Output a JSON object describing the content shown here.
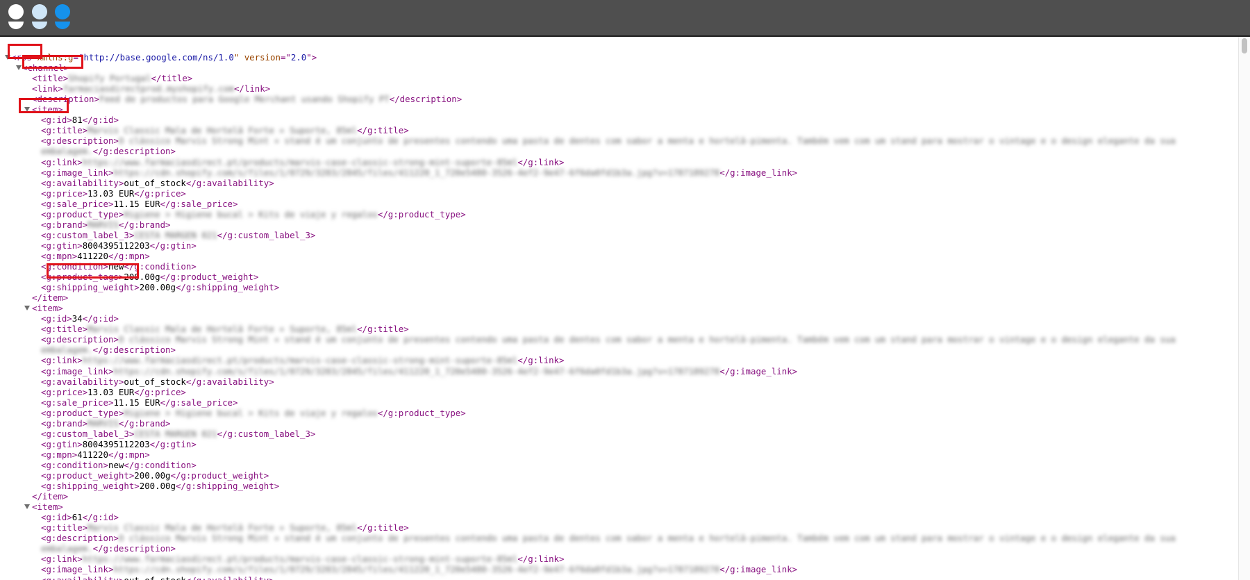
{
  "window": {
    "traffic_lights": [
      {
        "name": "close-button",
        "color": "#ffffff"
      },
      {
        "name": "minimize-button",
        "color": "#cfe6f8"
      },
      {
        "name": "zoom-button",
        "color": "#1592ec"
      }
    ]
  },
  "document": {
    "rss_open_tag": "<rss",
    "rss_attr1_name": " xmlns:g",
    "rss_attr1_eq": "=\"",
    "rss_attr1_value": "http://base.google.com/ns/1.0",
    "rss_attr2_name": "\" version",
    "rss_attr2_eq": "=\"",
    "rss_attr2_value": "2.0",
    "rss_end": "\">",
    "channel_open": "<channel>",
    "channel_title_open": "<title>",
    "channel_title_value": "Shopify Portugal",
    "channel_title_close": "</title>",
    "channel_link_open": "<link>",
    "channel_link_value": "farmaciasdirectprod.myshopify.com",
    "channel_link_close": "</link>",
    "channel_description_open": "<description>",
    "channel_description_value": "Feed de productos para Google Merchant usando Shopify PT",
    "channel_description_close": "</description>",
    "item_open": "<item>",
    "item_close": "</item>",
    "items": [
      {
        "id": "81",
        "title": "Marvis Classic Mala de Hortelã Forte + Suporte, 85ml",
        "description_line1": "O clássico Marvis Strong Mint + stand é um conjunto de presentes contendo uma pasta de dentes com sabor a menta e hortelã-pimenta. Também vem com um stand para mostrar o vintage e o design elegante da sua",
        "description_line2": "embalagem.",
        "link": "https://www.farmaciasdirect.pt/products/marvis-case-classic-strong-mint-suporte-85ml",
        "image_link": "https://cdn.shopify.com/s/files/1/0729/3203/2845/files/411220_1_720e5480-3526-4ef2-9e47-6f6da0fd1b3a.jpg?v=1787189278",
        "availability": "out_of_stock",
        "price": "13.03 EUR",
        "sale_price": "11.15 EUR",
        "product_type": "Higiene > Higiene bucal > Kits de viaje y regalos",
        "brand": "MARVIS",
        "custom_label_3": "CESTA MARGEN 021",
        "gtin": "8004395112203",
        "mpn": "411220",
        "condition": "new",
        "weight_open": "<g:product_tags>",
        "weight_value": "200.00g",
        "weight_close": "</g:product_weight>",
        "shipping_weight": "200.00g"
      },
      {
        "id": "34",
        "title": "Marvis Classic Mala de Hortelã Forte + Suporte, 85ml",
        "description_line1": "O clássico Marvis Strong Mint + stand é um conjunto de presentes contendo uma pasta de dentes com sabor a menta e hortelã-pimenta. Também vem com um stand para mostrar o vintage e o design elegante da sua",
        "description_line2": "embalagem.",
        "link": "https://www.farmaciasdirect.pt/products/marvis-case-classic-strong-mint-suporte-85ml",
        "image_link": "https://cdn.shopify.com/s/files/1/0729/3203/2845/files/411220_1_720e5480-3526-4ef2-9e47-6f6da0fd1b3a.jpg?v=1787189278",
        "availability": "out_of_stock",
        "price": "13.03 EUR",
        "sale_price": "11.15 EUR",
        "product_type": "Higiene > Higiene bucal > Kits de viaje y regalos",
        "brand": "MARVIS",
        "custom_label_3": "CESTA MARGEN 021",
        "gtin": "8004395112203",
        "mpn": "411220",
        "condition": "new",
        "weight_open": "<g:product_weight>",
        "weight_value": "200.00g",
        "weight_close": "</g:product_weight>",
        "shipping_weight": "200.00g"
      },
      {
        "id": "61",
        "title": "Marvis Classic Mala de Hortelã Forte + Suporte, 85ml",
        "description_line1": "O clássico Marvis Strong Mint + stand é um conjunto de presentes contendo uma pasta de dentes com sabor a menta e hortelã-pimenta. Também vem com um stand para mostrar o vintage e o design elegante da sua",
        "description_line2": "embalagem.",
        "link": "https://www.farmaciasdirect.pt/products/marvis-case-classic-strong-mint-suporte-85ml",
        "image_link": "https://cdn.shopify.com/s/files/1/0729/3203/2845/files/411220_1_720e5480-3526-4ef2-9e47-6f6da0fd1b3a.jpg?v=1787189278",
        "availability": "out_of_stock"
      }
    ]
  },
  "colors": {
    "tag": "#881280",
    "attribute_name": "#994500",
    "attribute_value": "#1a1aa6",
    "text": "#000000",
    "highlight_box": "#e0121a"
  }
}
